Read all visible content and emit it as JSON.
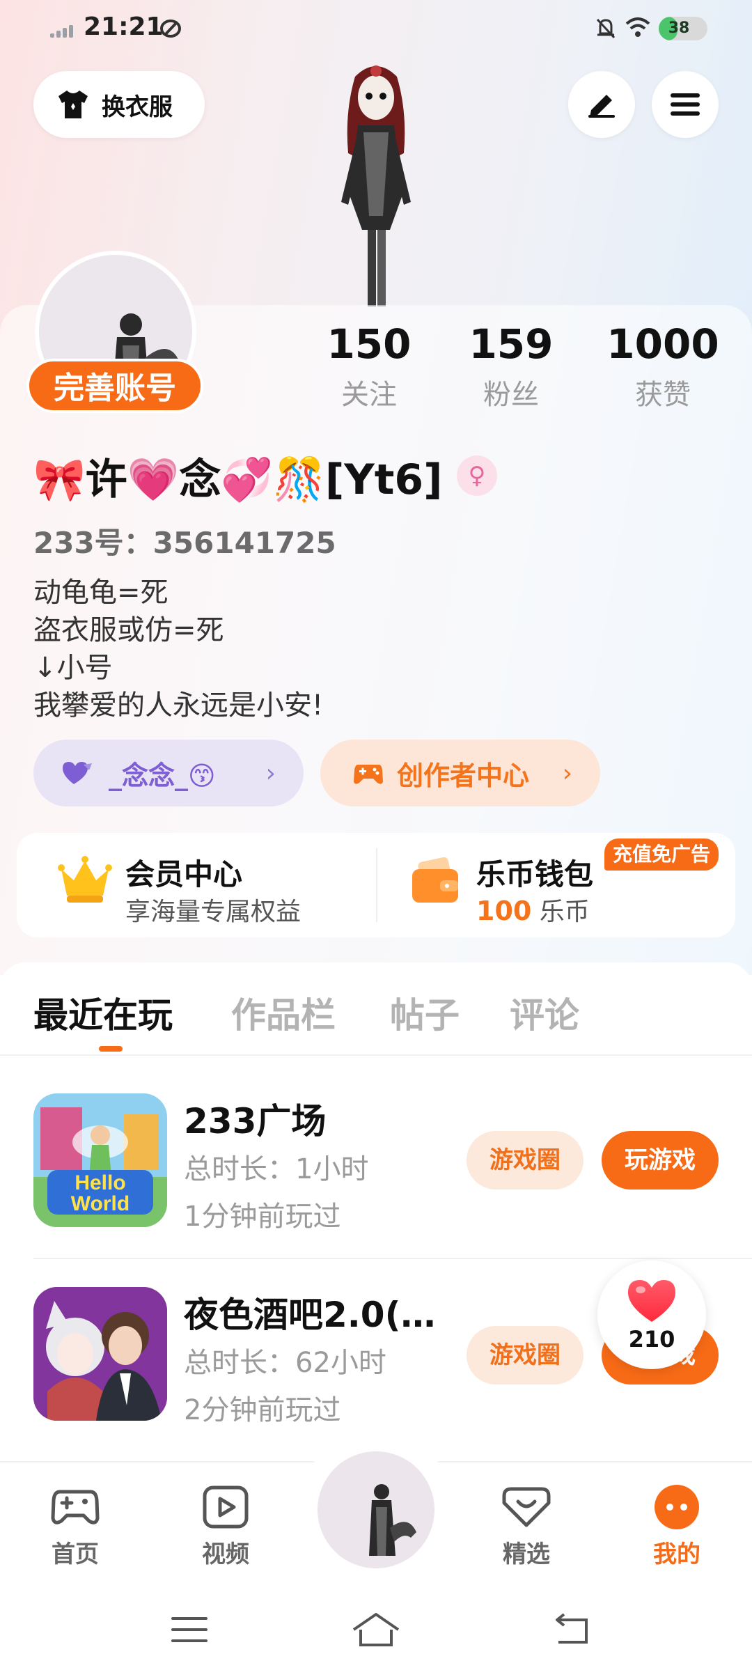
{
  "status_bar": {
    "time": "21:21",
    "battery": "38",
    "battery_level": 0.38
  },
  "top": {
    "outfit_label": "换衣服",
    "edit_icon": "pen-icon",
    "menu_icon": "menu-icon"
  },
  "profile": {
    "complete_account_label": "完善账号",
    "stats": [
      {
        "value": "150",
        "label": "关注"
      },
      {
        "value": "159",
        "label": "粉丝"
      },
      {
        "value": "1000",
        "label": "获赞"
      }
    ],
    "nickname": "🎀许💗念💞🎊[Yt6]",
    "gender_symbol": "♀",
    "uid": "233号：356141725",
    "bio": [
      "动龟龟=死",
      "盗衣服或仿=死",
      "↓小号",
      "我攀爱的人永远是小安!"
    ],
    "fan_group_label": "_念念_😙",
    "creator_center_label": "创作者中心"
  },
  "cards": {
    "member_title": "会员中心",
    "member_subtitle": "享海量专属权益",
    "wallet_title": "乐币钱包",
    "wallet_amount": "100",
    "wallet_unit": "乐币",
    "ad_badge": "充值免广告"
  },
  "tabs": [
    {
      "label": "最近在玩",
      "active": true
    },
    {
      "label": "作品栏",
      "active": false
    },
    {
      "label": "帖子",
      "active": false
    },
    {
      "label": "评论",
      "active": false
    }
  ],
  "games": [
    {
      "title": "233广场",
      "duration": "总时长：1小时",
      "last_played": "1分钟前玩过",
      "circle_label": "游戏圈",
      "play_label": "玩游戏",
      "icon_text": "Hello World"
    },
    {
      "title": "夜色酒吧2.0(…",
      "duration": "总时长：62小时",
      "last_played": "2分钟前玩过",
      "circle_label": "游戏圈",
      "play_label": "玩游戏"
    }
  ],
  "like_float": {
    "count": "210"
  },
  "bottom_nav": [
    {
      "label": "首页",
      "icon": "gamepad-icon"
    },
    {
      "label": "视频",
      "icon": "video-icon"
    },
    {
      "label": "精选",
      "icon": "heart-box-icon"
    },
    {
      "label": "我的",
      "icon": "profile-face-icon",
      "active": true
    }
  ],
  "colors": {
    "accent": "#f86b16",
    "muted": "#9a9a9a",
    "purple": "#7d5fd3"
  }
}
